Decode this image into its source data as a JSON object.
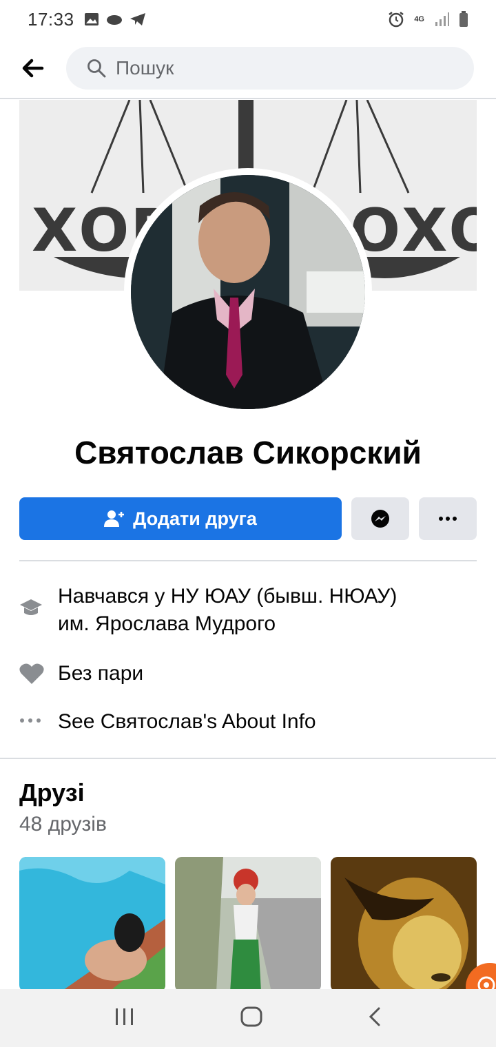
{
  "status_bar": {
    "time": "17:33",
    "network": "4G"
  },
  "search": {
    "placeholder": "Пошук"
  },
  "cover": {
    "left_word": "ХОРО",
    "right_word": "ОХО"
  },
  "profile": {
    "name": "Святослав Сикорский"
  },
  "actions": {
    "add_friend_label": "Додати друга"
  },
  "intro": {
    "education_line1": "Навчався у НУ ЮАУ (бывш. НЮАУ)",
    "education_line2": "им. Ярослава Мудрого",
    "relationship": "Без пари",
    "about_link": "See Святослав's About Info"
  },
  "friends": {
    "title": "Друзі",
    "count_label": "48 друзів"
  },
  "colors": {
    "primary": "#1b74e4",
    "secondary_button": "#e4e6eb",
    "divider": "#dadde1",
    "muted_text": "#65676b"
  }
}
